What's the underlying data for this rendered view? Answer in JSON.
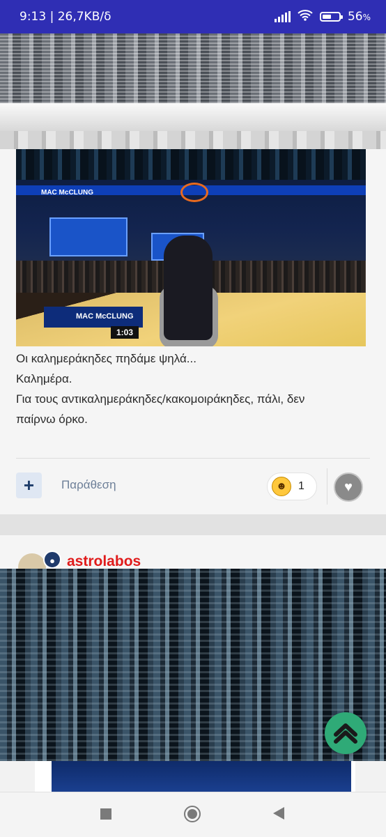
{
  "status_bar": {
    "time_speed": "9:13 | 26,7KB/δ",
    "battery_percent": "56",
    "battery_suffix": "%",
    "battery_level": 0.56,
    "icons": [
      "signal-icon",
      "wifi-icon",
      "battery-icon"
    ]
  },
  "post": {
    "media_overlay": {
      "scoreboard_name": "MAC McCLUNG",
      "overlay_name": "MAC McCLUNG",
      "clock": "1:03"
    },
    "text_lines": [
      "Οι καλημεράκηδες πηδάμε ψηλά...",
      "Καλημέρα.",
      "Για τους αντικαλημεράκηδες/κακομοιράκηδες, πάλι, δεν",
      "παίρνω όρκο."
    ],
    "actions": {
      "plus_label": "+",
      "quote_label": "Παράθεση",
      "reaction_count": "1",
      "reaction_icon": "laughing-emoji-icon",
      "like_icon": "heart-icon"
    }
  },
  "next_post": {
    "author_name": "astrolabos",
    "badge_icon": "shield-icon"
  },
  "navigation": {
    "icons": [
      "recents-square-icon",
      "home-circle-icon",
      "back-triangle-icon"
    ]
  },
  "colors": {
    "status_bar_bg": "#2f2eb4",
    "author_name": "#e01b1b",
    "scroll_top_button": "#2faa77",
    "quote_link": "#6d7f98"
  }
}
